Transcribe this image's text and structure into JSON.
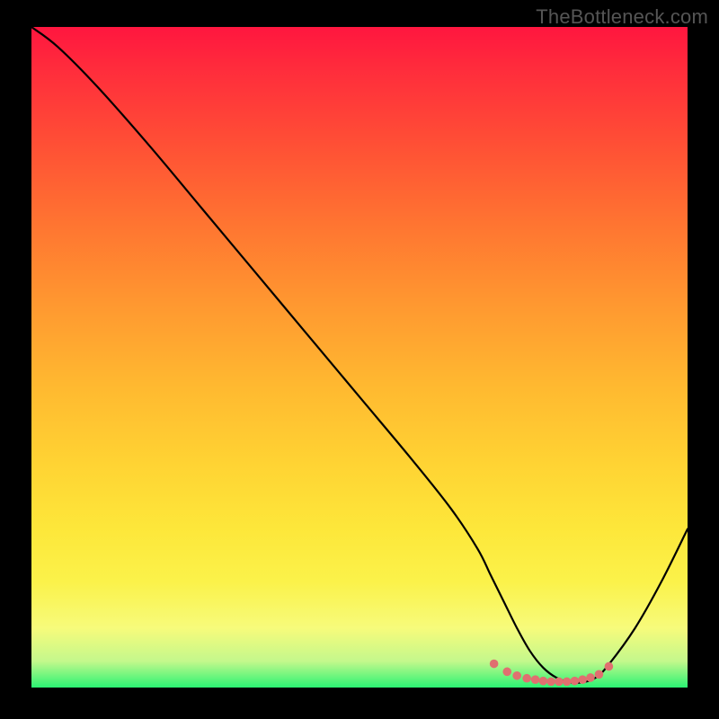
{
  "watermark": "TheBottleneck.com",
  "chart_data": {
    "type": "line",
    "title": "",
    "xlabel": "",
    "ylabel": "",
    "xlim": [
      0,
      100
    ],
    "ylim": [
      0,
      100
    ],
    "grid": false,
    "series": [
      {
        "name": "curve",
        "color": "#000000",
        "x": [
          0,
          4,
          10,
          18,
          26,
          34,
          42,
          50,
          58,
          64,
          68,
          70,
          72,
          74,
          76,
          78,
          80,
          82,
          84,
          86,
          88,
          92,
          96,
          100
        ],
        "y": [
          100,
          97,
          91,
          82,
          72.5,
          63,
          53.5,
          44,
          34.5,
          27,
          21,
          17,
          13,
          9,
          5.5,
          3,
          1.5,
          0.8,
          0.8,
          1.5,
          3.5,
          9,
          16,
          24
        ]
      }
    ],
    "markers": {
      "name": "valley-dots",
      "color": "#e07070",
      "x": [
        70.5,
        72.5,
        74,
        75.5,
        76.8,
        78,
        79.2,
        80.4,
        81.6,
        82.8,
        84,
        85.2,
        86.5,
        88
      ],
      "y": [
        3.6,
        2.4,
        1.8,
        1.4,
        1.2,
        1.0,
        0.9,
        0.9,
        0.9,
        1.0,
        1.2,
        1.5,
        2.0,
        3.2
      ]
    }
  }
}
